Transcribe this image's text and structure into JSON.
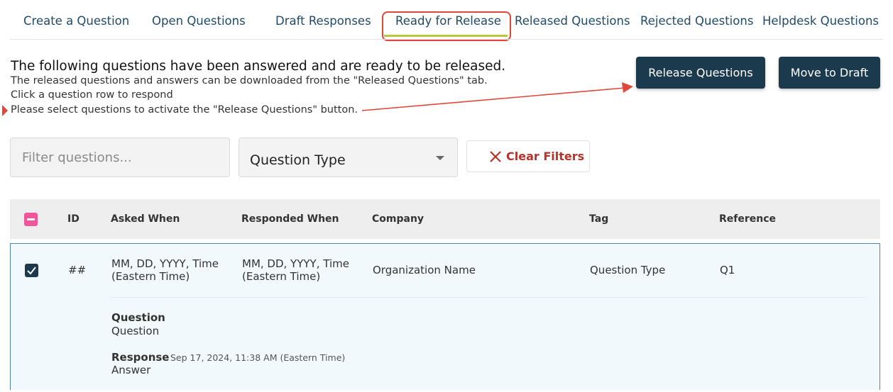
{
  "tabs": [
    {
      "label": "Create a Question"
    },
    {
      "label": "Open Questions"
    },
    {
      "label": "Draft Responses"
    },
    {
      "label": "Ready for Release"
    },
    {
      "label": "Released Questions"
    },
    {
      "label": "Rejected Questions"
    },
    {
      "label": "Helpdesk Questions"
    }
  ],
  "active_tab": "Ready for Release",
  "intro": {
    "heading": "The following questions have been answered and are ready to be released.",
    "line1": "The released questions and answers can be downloaded from the \"Released Questions\" tab.",
    "line2": "Click a question row to respond",
    "line3": "Please select questions to activate the \"Release Questions\" button."
  },
  "buttons": {
    "release": "Release Questions",
    "move_to_draft": "Move to Draft"
  },
  "filters": {
    "search_placeholder": "Filter questions...",
    "type_select": "Question Type",
    "clear": "Clear Filters"
  },
  "table": {
    "columns": [
      "ID",
      "Asked When",
      "Responded When",
      "Company",
      "Tag",
      "Reference"
    ],
    "rows": [
      {
        "selected": true,
        "id": "##",
        "asked_line1": "MM, DD, YYYY, Time",
        "asked_line2": "(Eastern Time)",
        "responded_line1": "MM, DD, YYYY, Time",
        "responded_line2": "(Eastern Time)",
        "company": "Organization Name",
        "tag": "Question Type",
        "reference": "Q1",
        "question_label": "Question",
        "question_value": "Question",
        "response_label": "Response",
        "response_time": "Sep 17, 2024, 11:38 AM (Eastern Time)",
        "response_value": "Answer"
      }
    ]
  },
  "colors": {
    "primary": "#1c3a4d",
    "tab_text": "#1f4a6a",
    "annotation": "#e0473a",
    "tab_underline": "#b9c93a",
    "header_check": "#f0569a",
    "clear_text": "#b7332a"
  }
}
